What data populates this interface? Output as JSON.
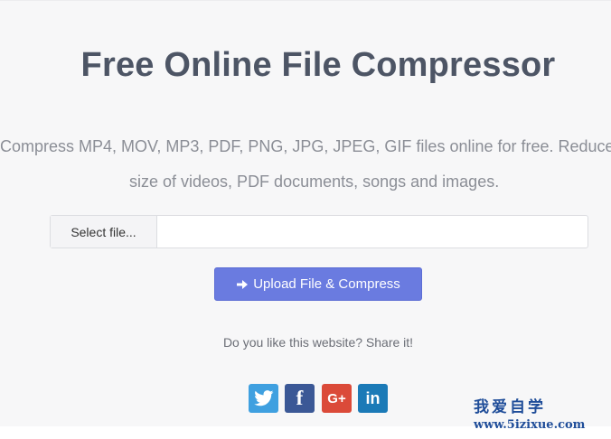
{
  "header": {
    "title": "Free Online File Compressor",
    "description_line1": "Compress MP4, MOV, MP3, PDF, PNG, JPG, JPEG, GIF files online for free. Reduce",
    "description_line2": "size of videos, PDF documents, songs and images."
  },
  "upload": {
    "select_file_label": "Select file...",
    "file_path_value": "",
    "upload_button_label": "Upload File & Compress"
  },
  "share": {
    "prompt": "Do you like this website? Share it!",
    "buttons": [
      {
        "name": "twitter",
        "color": "#3fa0e0",
        "glyph": ""
      },
      {
        "name": "facebook",
        "color": "#3b5896",
        "glyph": "f"
      },
      {
        "name": "google-plus",
        "color": "#db4a39",
        "glyph": "G+"
      },
      {
        "name": "linkedin",
        "color": "#1b7ab7",
        "glyph": "in"
      }
    ]
  },
  "watermark": {
    "line1": "我爱自学",
    "line2": "www.5izixue.com"
  },
  "colors": {
    "accent": "#6a7be0",
    "title": "#4d5565",
    "watermark": "#1f4d99"
  }
}
